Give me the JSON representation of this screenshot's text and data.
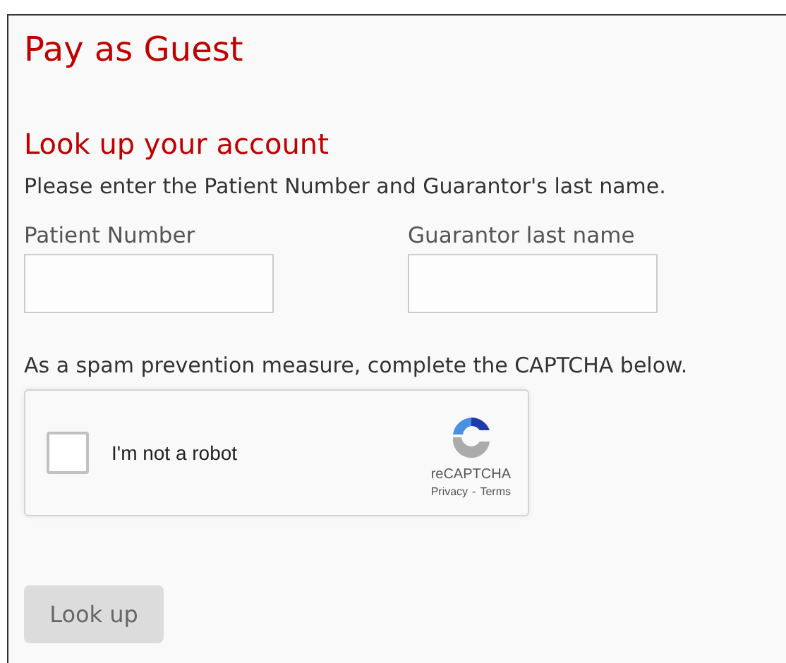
{
  "title": "Pay as Guest",
  "section": {
    "heading": "Look up your account",
    "instructions": "Please enter the Patient Number and Guarantor's last name."
  },
  "fields": [
    {
      "label": "Patient Number"
    },
    {
      "label": "Guarantor last name"
    }
  ],
  "captcha": {
    "intro": "As a spam prevention measure, complete the CAPTCHA below.",
    "label": "I'm not a robot",
    "checked": false,
    "brand": "reCAPTCHA",
    "links": [
      "Privacy",
      "Terms"
    ],
    "separator": "-"
  },
  "button": {
    "label": "Look up",
    "disabled": true
  }
}
